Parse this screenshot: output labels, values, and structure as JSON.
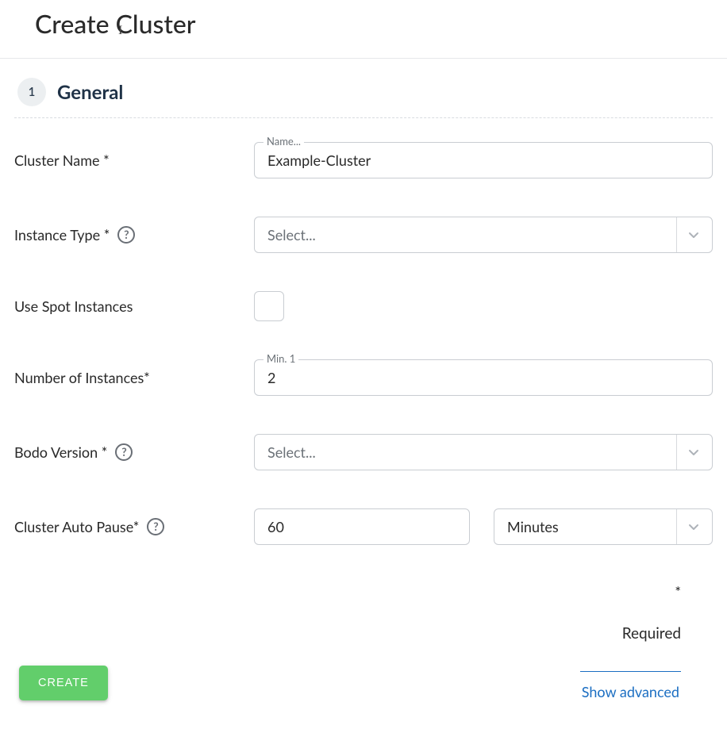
{
  "page": {
    "title": "Create Cluster"
  },
  "section": {
    "step_number": "1",
    "title": "General"
  },
  "fields": {
    "cluster_name": {
      "label": "Cluster Name *",
      "float_label": "Name...",
      "value": "Example-Cluster"
    },
    "instance_type": {
      "label": "Instance Type *",
      "placeholder": "Select..."
    },
    "use_spot": {
      "label": "Use Spot Instances",
      "checked": false
    },
    "num_instances": {
      "label": "Number of Instances*",
      "float_label": "Min. 1",
      "value": "2"
    },
    "bodo_version": {
      "label": "Bodo Version *",
      "placeholder": "Select..."
    },
    "auto_pause": {
      "label": "Cluster Auto Pause*",
      "value": "60",
      "unit_selected": "Minutes"
    }
  },
  "footer": {
    "required_star": "*",
    "required_text": "Required",
    "show_advanced": "Show advanced",
    "create_button": "CREATE"
  }
}
